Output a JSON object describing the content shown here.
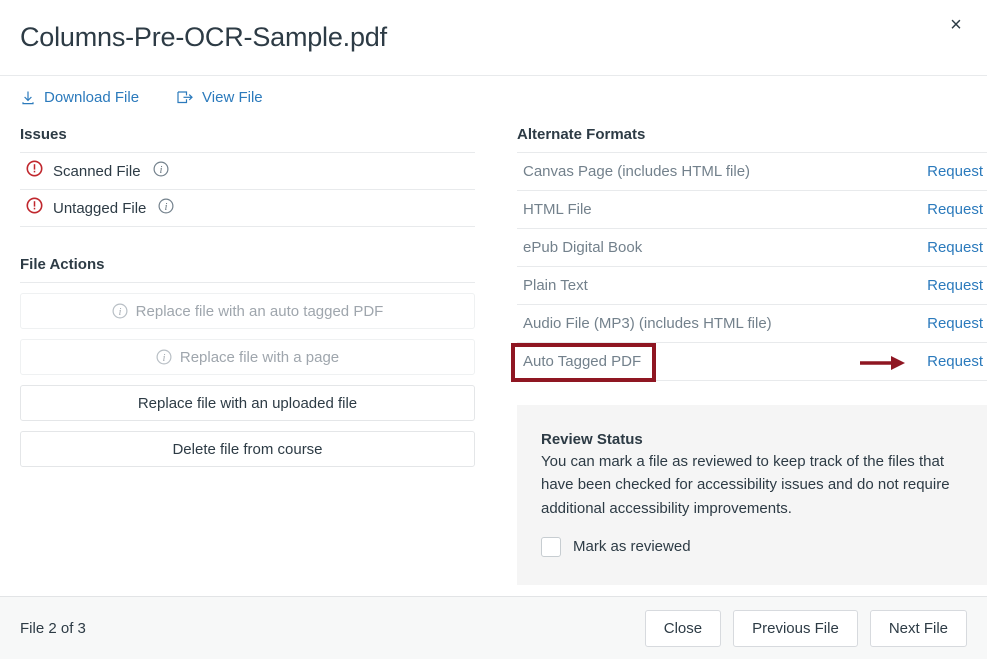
{
  "header": {
    "title": "Columns-Pre-OCR-Sample.pdf",
    "close_label": "×"
  },
  "toolbar": {
    "download_label": "Download File",
    "view_label": "View File",
    "download_icon": "download-icon",
    "view_icon": "external-view-icon"
  },
  "issues": {
    "section_title": "Issues",
    "items": [
      {
        "label": "Scanned File",
        "status_icon": "error-circle-icon",
        "info_icon": "info-circle-icon"
      },
      {
        "label": "Untagged File",
        "status_icon": "error-circle-icon",
        "info_icon": "info-circle-icon"
      }
    ]
  },
  "file_actions": {
    "section_title": "File Actions",
    "buttons": [
      {
        "label": "Replace file with an auto tagged PDF",
        "disabled": true,
        "info_icon": "info-circle-icon"
      },
      {
        "label": "Replace file with a page",
        "disabled": true,
        "info_icon": "info-circle-icon"
      },
      {
        "label": "Replace file with an uploaded file",
        "disabled": false
      },
      {
        "label": "Delete file from course",
        "disabled": false
      }
    ]
  },
  "alternate_formats": {
    "section_title": "Alternate Formats",
    "rows": [
      {
        "label": "Canvas Page (includes HTML file)",
        "action": "Request"
      },
      {
        "label": "HTML File",
        "action": "Request"
      },
      {
        "label": "ePub Digital Book",
        "action": "Request"
      },
      {
        "label": "Plain Text",
        "action": "Request"
      },
      {
        "label": "Audio File (MP3) (includes HTML file)",
        "action": "Request"
      },
      {
        "label": "Auto Tagged PDF",
        "action": "Request"
      }
    ]
  },
  "review_status": {
    "title": "Review Status",
    "description": "You can mark a file as reviewed to keep track of the files that have been checked for accessibility issues and do not require additional accessibility improvements.",
    "checkbox_label": "Mark as reviewed",
    "checked": false
  },
  "footer": {
    "file_counter": "File 2 of 3",
    "buttons": [
      {
        "label": "Close"
      },
      {
        "label": "Previous File"
      },
      {
        "label": "Next File"
      }
    ]
  },
  "annotations": {
    "highlight_color": "#8f1622",
    "arrow_color": "#8f1622"
  },
  "colors": {
    "link": "#2b7abc",
    "text": "#2d3b45",
    "muted": "#73818c",
    "error": "#c0272d",
    "panel_bg": "#f5f5f5",
    "footer_bg": "#f7f8f8",
    "divider": "#e8eaec"
  }
}
